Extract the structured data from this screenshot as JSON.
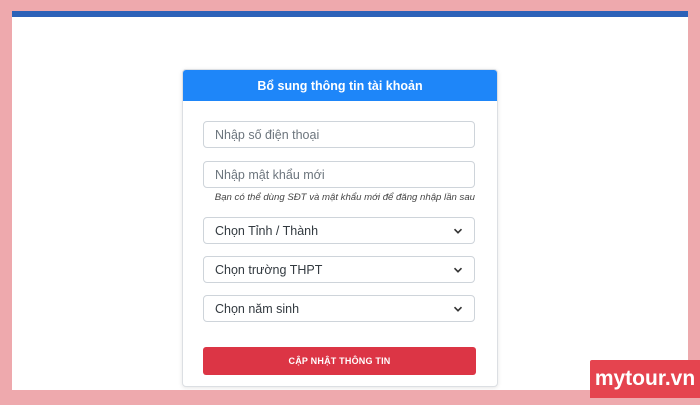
{
  "form": {
    "title": "Bổ sung thông tin tài khoản",
    "phone_placeholder": "Nhập số điện thoại",
    "password_placeholder": "Nhập mật khẩu mới",
    "hint": "Bạn có thể dùng SĐT và mật khẩu mới để đăng nhập lần sau",
    "province_select": "Chọn Tỉnh / Thành",
    "school_select": "Chọn trường THPT",
    "birth_year_select": "Chọn năm sinh",
    "submit_label": "CẬP NHẬT THÔNG TIN"
  },
  "watermark": {
    "text": "mytour.vn"
  },
  "colors": {
    "header": "#1e86f9",
    "button": "#dc3545",
    "topbar": "#2d62b8",
    "frame": "#eea9ad",
    "watermark": "#e5444f"
  },
  "icons": {
    "select_arrow": "chevron-down-icon"
  }
}
